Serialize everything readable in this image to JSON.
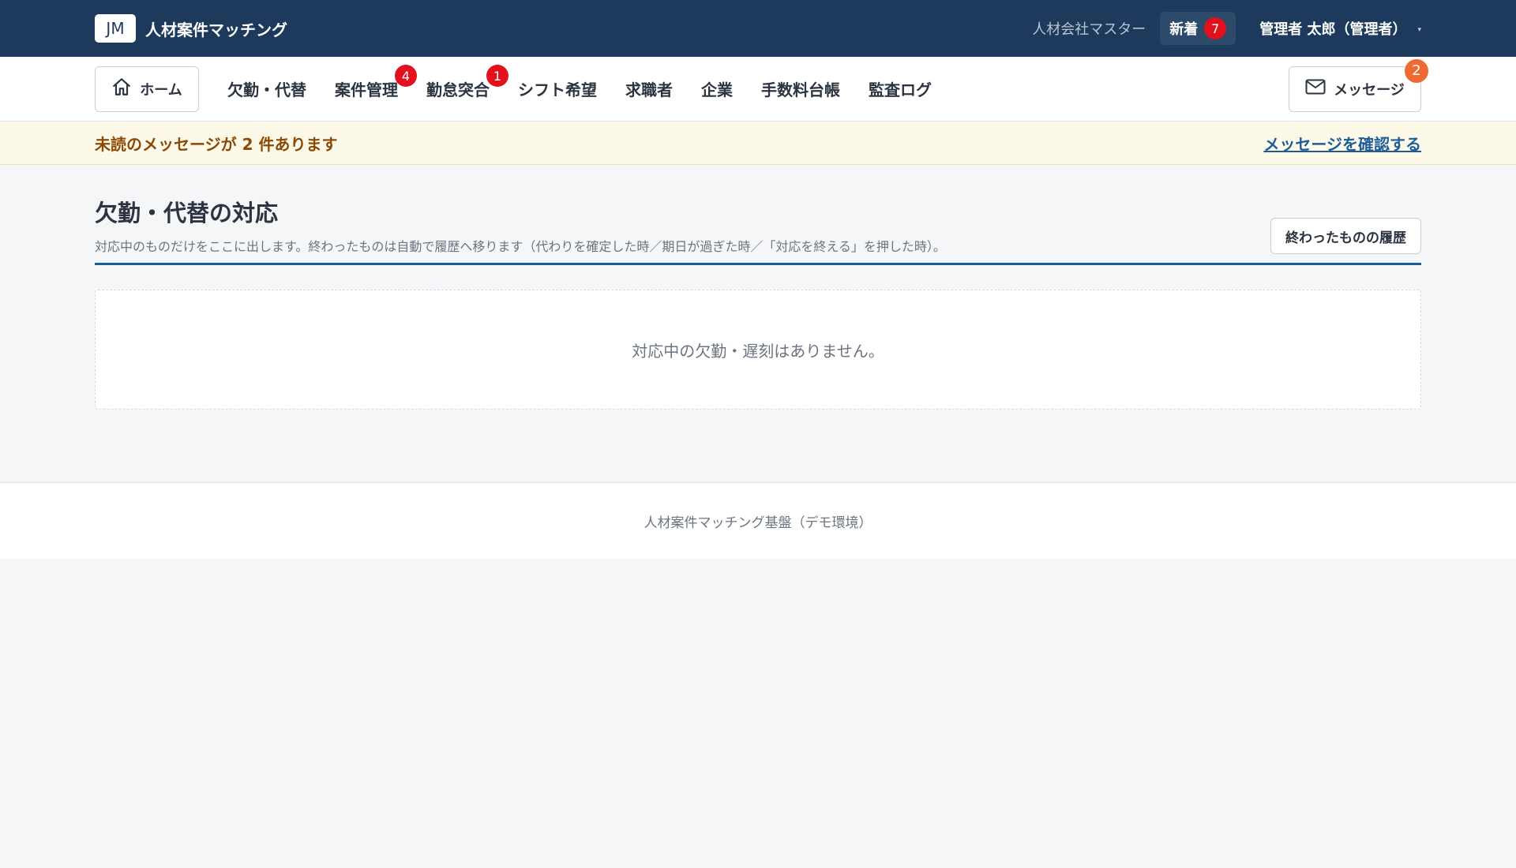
{
  "header": {
    "logo_text": "JM",
    "app_title": "人材案件マッチング",
    "tenant": "人材会社マスター",
    "new_label": "新着",
    "new_count": "7",
    "user": "管理者 太郎（管理者）",
    "user_caret": "▾"
  },
  "nav": {
    "home_label": "ホーム",
    "items": [
      {
        "label": "欠勤・代替",
        "badge": ""
      },
      {
        "label": "案件管理",
        "badge": "4"
      },
      {
        "label": "勤怠突合",
        "badge": "1"
      },
      {
        "label": "シフト希望",
        "badge": ""
      },
      {
        "label": "求職者",
        "badge": ""
      },
      {
        "label": "企業",
        "badge": ""
      },
      {
        "label": "手数料台帳",
        "badge": ""
      },
      {
        "label": "監査ログ",
        "badge": ""
      }
    ],
    "messages_label": "メッセージ",
    "messages_badge": "2"
  },
  "notice": {
    "text": "未読のメッセージが 2 件あります",
    "link": "メッセージを確認する"
  },
  "main": {
    "title": "欠勤・代替の対応",
    "description": "対応中のものだけをここに出します。終わったものは自動で履歴へ移ります（代わりを確定した時／期日が過ぎた時／「対応を終える」を押した時）。",
    "history_button": "終わったものの履歴",
    "empty_text": "対応中の欠勤・遅刻はありません。"
  },
  "footer": {
    "text": "人材案件マッチング基盤（デモ環境）"
  },
  "colors": {
    "topbar": "#1d3a5c",
    "accent": "#1b5e96",
    "badge_red": "#e3101d",
    "badge_orange": "#ef6a32",
    "notice_bg": "#fdf9e9"
  },
  "icons": {
    "home": "home-icon",
    "messages": "mail-icon"
  }
}
